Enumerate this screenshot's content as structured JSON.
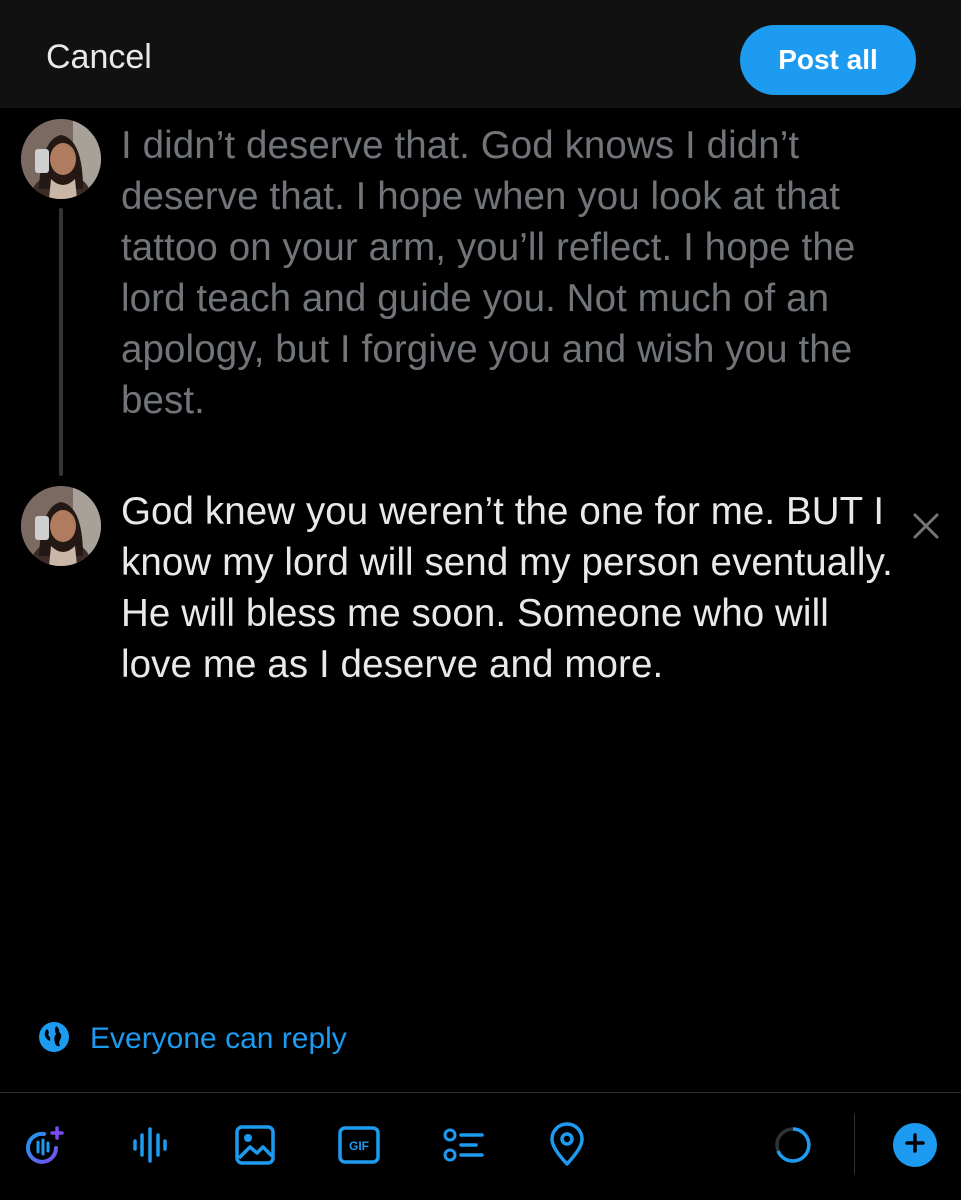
{
  "header": {
    "cancel_label": "Cancel",
    "post_all_label": "Post all"
  },
  "thread": [
    {
      "text": "I didn’t deserve that. God knows I didn’t deserve that. I hope when you look at that tattoo on your arm, you’ll reflect. I hope the lord teach and guide you. Not much of an apology, but I forgive you and wish you the best.",
      "state": "dimmed"
    },
    {
      "text": "God knew you weren’t the one for me. BUT I know my lord will send my person eventually. He will bless me soon. Someone who will love me as I deserve and more.",
      "state": "active"
    }
  ],
  "reply_setting": {
    "icon": "globe-icon",
    "label": "Everyone can reply"
  },
  "toolbar": {
    "icons": [
      "grok-icon",
      "audio-wave-icon",
      "image-icon",
      "gif-icon",
      "poll-icon",
      "location-icon",
      "character-count-ring",
      "add-post-icon"
    ],
    "gif_text": "GIF"
  },
  "colors": {
    "accent": "#1d9bf0",
    "background": "#000000",
    "header_background": "#111111",
    "dimmed_text": "#717579",
    "text": "#e7e9ea"
  }
}
